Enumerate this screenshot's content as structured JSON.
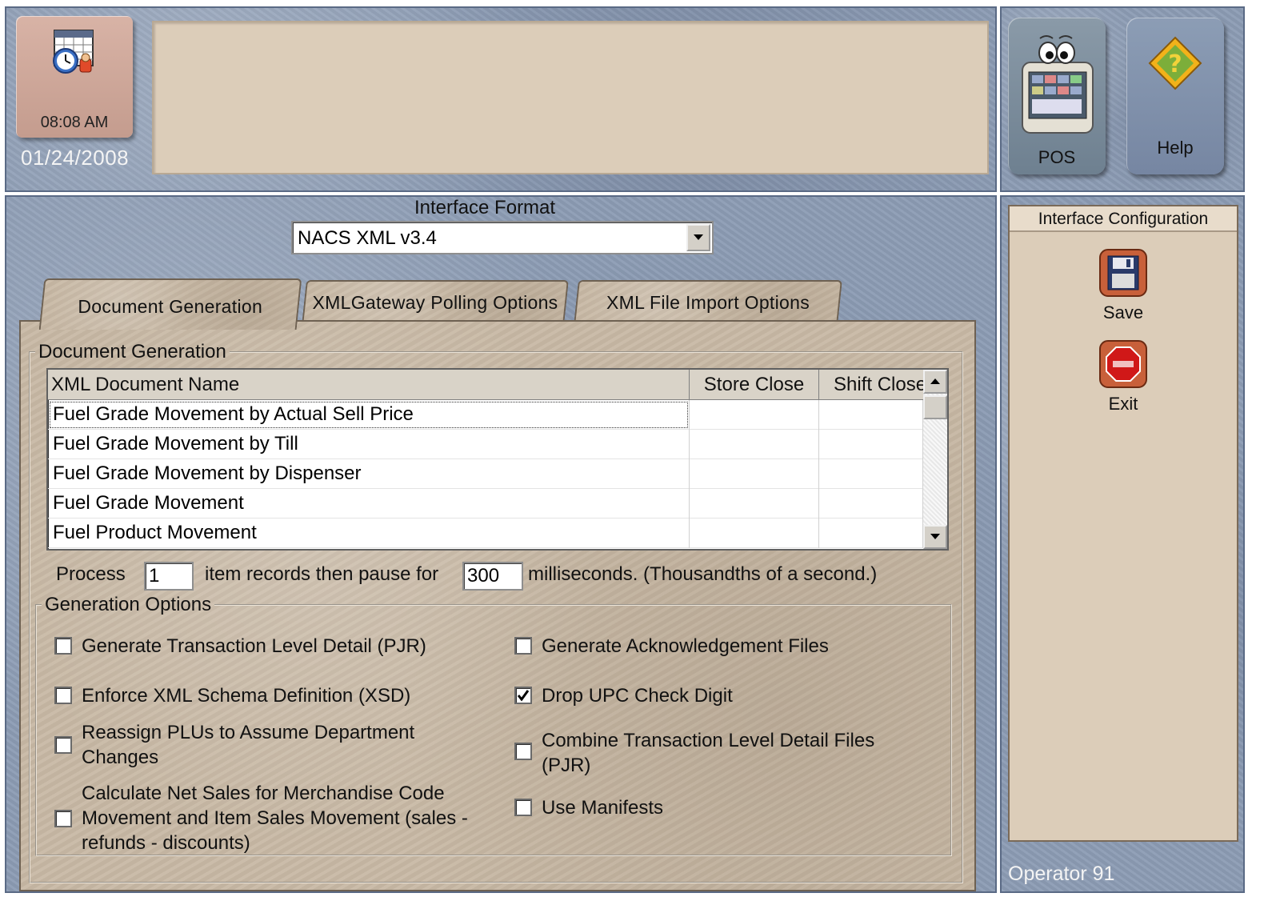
{
  "header": {
    "time": "08:08 AM",
    "date": "01/24/2008",
    "message": ""
  },
  "nav": {
    "pos_label": "POS",
    "help_label": "Help"
  },
  "right_panel": {
    "title": "Interface Configuration",
    "save_label": "Save",
    "exit_label": "Exit",
    "operator": "Operator 91"
  },
  "interface_format": {
    "label": "Interface Format",
    "selected": "NACS XML v3.4"
  },
  "tabs": [
    {
      "label": "Document Generation",
      "active": true
    },
    {
      "label": "XMLGateway Polling Options",
      "active": false
    },
    {
      "label": "XML File Import Options",
      "active": false
    }
  ],
  "document_generation": {
    "group_title": "Document Generation",
    "columns": [
      "XML Document Name",
      "Store Close",
      "Shift Close"
    ],
    "rows": [
      {
        "name": "Fuel Grade Movement by Actual Sell Price",
        "store_close": "",
        "shift_close": "",
        "selected": true
      },
      {
        "name": "Fuel Grade Movement by Till",
        "store_close": "",
        "shift_close": ""
      },
      {
        "name": "Fuel Grade Movement by Dispenser",
        "store_close": "",
        "shift_close": ""
      },
      {
        "name": "Fuel Grade Movement",
        "store_close": "",
        "shift_close": ""
      },
      {
        "name": "Fuel Product Movement",
        "store_close": "",
        "shift_close": ""
      }
    ],
    "process": {
      "label_before": "Process",
      "items_value": "1",
      "label_middle": "item records then pause for",
      "pause_value": "300",
      "label_after": "milliseconds. (Thousandths of a second.)"
    }
  },
  "generation_options": {
    "title": "Generation Options",
    "options": [
      {
        "label": "Generate Transaction Level Detail (PJR)",
        "checked": false
      },
      {
        "label": "Generate Acknowledgement Files",
        "checked": false
      },
      {
        "label": "Enforce XML Schema Definition (XSD)",
        "checked": false
      },
      {
        "label": "Drop UPC Check Digit",
        "checked": true
      },
      {
        "label_line1": "Reassign PLUs to Assume Department",
        "label_line2": "Changes",
        "checked": false
      },
      {
        "label_line1": "Combine Transaction Level Detail Files",
        "label_line2": "(PJR)",
        "checked": false
      },
      {
        "label_line1": "Calculate Net Sales for Merchandise Code",
        "label_line2": "Movement and Item Sales Movement  (sales -",
        "label_line3": "refunds - discounts)",
        "checked": false
      },
      {
        "label": "Use Manifests",
        "checked": false
      }
    ]
  },
  "icons": {
    "clock": "calendar-clock-icon",
    "pos": "pos-terminal-face-icon",
    "help": "help-diamond-icon",
    "save": "floppy-disk-icon",
    "exit": "stop-sign-icon",
    "dropdown": "chevron-down-icon",
    "scroll_up": "arrow-up-icon",
    "scroll_down": "arrow-down-icon",
    "check": "check-icon"
  }
}
